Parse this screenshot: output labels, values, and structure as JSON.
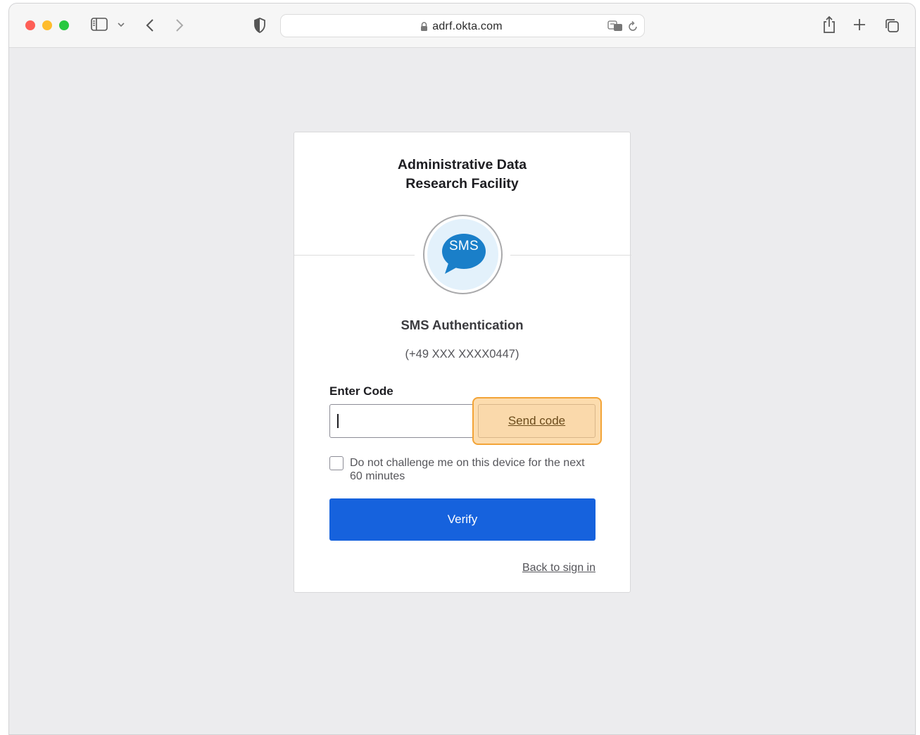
{
  "browser": {
    "url": "adrf.okta.com"
  },
  "card": {
    "org_title_line1": "Administrative Data",
    "org_title_line2": "Research Facility",
    "factor_logo_text": "SMS",
    "factor_title": "SMS Authentication",
    "phone_number": "(+49 XXX XXXX0447)",
    "code_label": "Enter Code",
    "code_value": "",
    "send_code_label": "Send code",
    "remember_label": "Do not challenge me on this device for the next 60 minutes",
    "remember_checked": false,
    "verify_label": "Verify",
    "back_link_label": "Back to sign in"
  },
  "colors": {
    "primary": "#1662dd",
    "highlight_fill": "#fcdcae",
    "highlight_border": "#f3a437",
    "sms_bubble": "#1a7fc9"
  }
}
